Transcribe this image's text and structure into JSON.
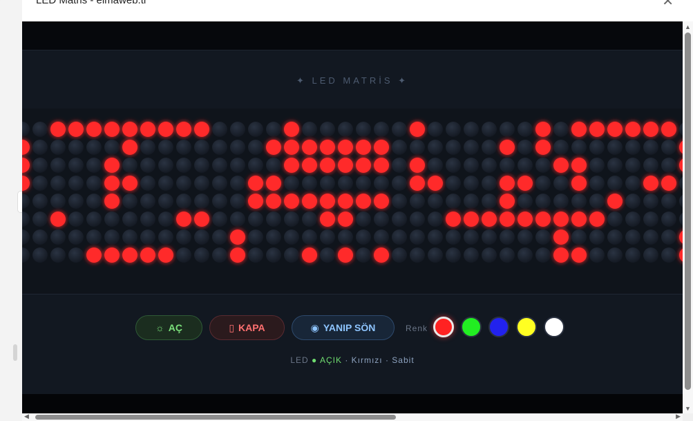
{
  "window": {
    "title": "LED Matris - elmaweb.tr",
    "close_icon": "close-icon"
  },
  "header": {
    "title": "✦ LED MATRİS ✦"
  },
  "matrix": {
    "led_on_color": "#ff2a2a",
    "led_off_color": "#1c2330",
    "rows": [
      "..#########....#......#......#.######..",
      "#.....#.......#######......#.#.......#.",
      "#....#.........######.#.......##.....##",
      "#....##......##.......##...##..#...##.#",
      ".....#.......########......#.....#.....",
      "..#......##......##.....#########......",
      "............#.................#......#.",
      "....#####...#...#.#.#.........##.....##"
    ]
  },
  "controls": {
    "on_button": {
      "icon": "☼",
      "label": "AÇ"
    },
    "off_button": {
      "icon": "▯",
      "label": "KAPA"
    },
    "blink_button": {
      "icon": "◉",
      "label": "YANIP SÖN"
    },
    "color_label": "Renk",
    "colors": [
      {
        "name": "red",
        "hex": "#ff2222",
        "selected": true
      },
      {
        "name": "green",
        "hex": "#22ee22",
        "selected": false
      },
      {
        "name": "blue",
        "hex": "#2222ee",
        "selected": false
      },
      {
        "name": "yellow",
        "hex": "#ffff22",
        "selected": false
      },
      {
        "name": "white",
        "hex": "#ffffff",
        "selected": false
      }
    ]
  },
  "status": {
    "prefix": "LED",
    "state": "● AÇIK",
    "details": "· Kırmızı · Sabit"
  }
}
